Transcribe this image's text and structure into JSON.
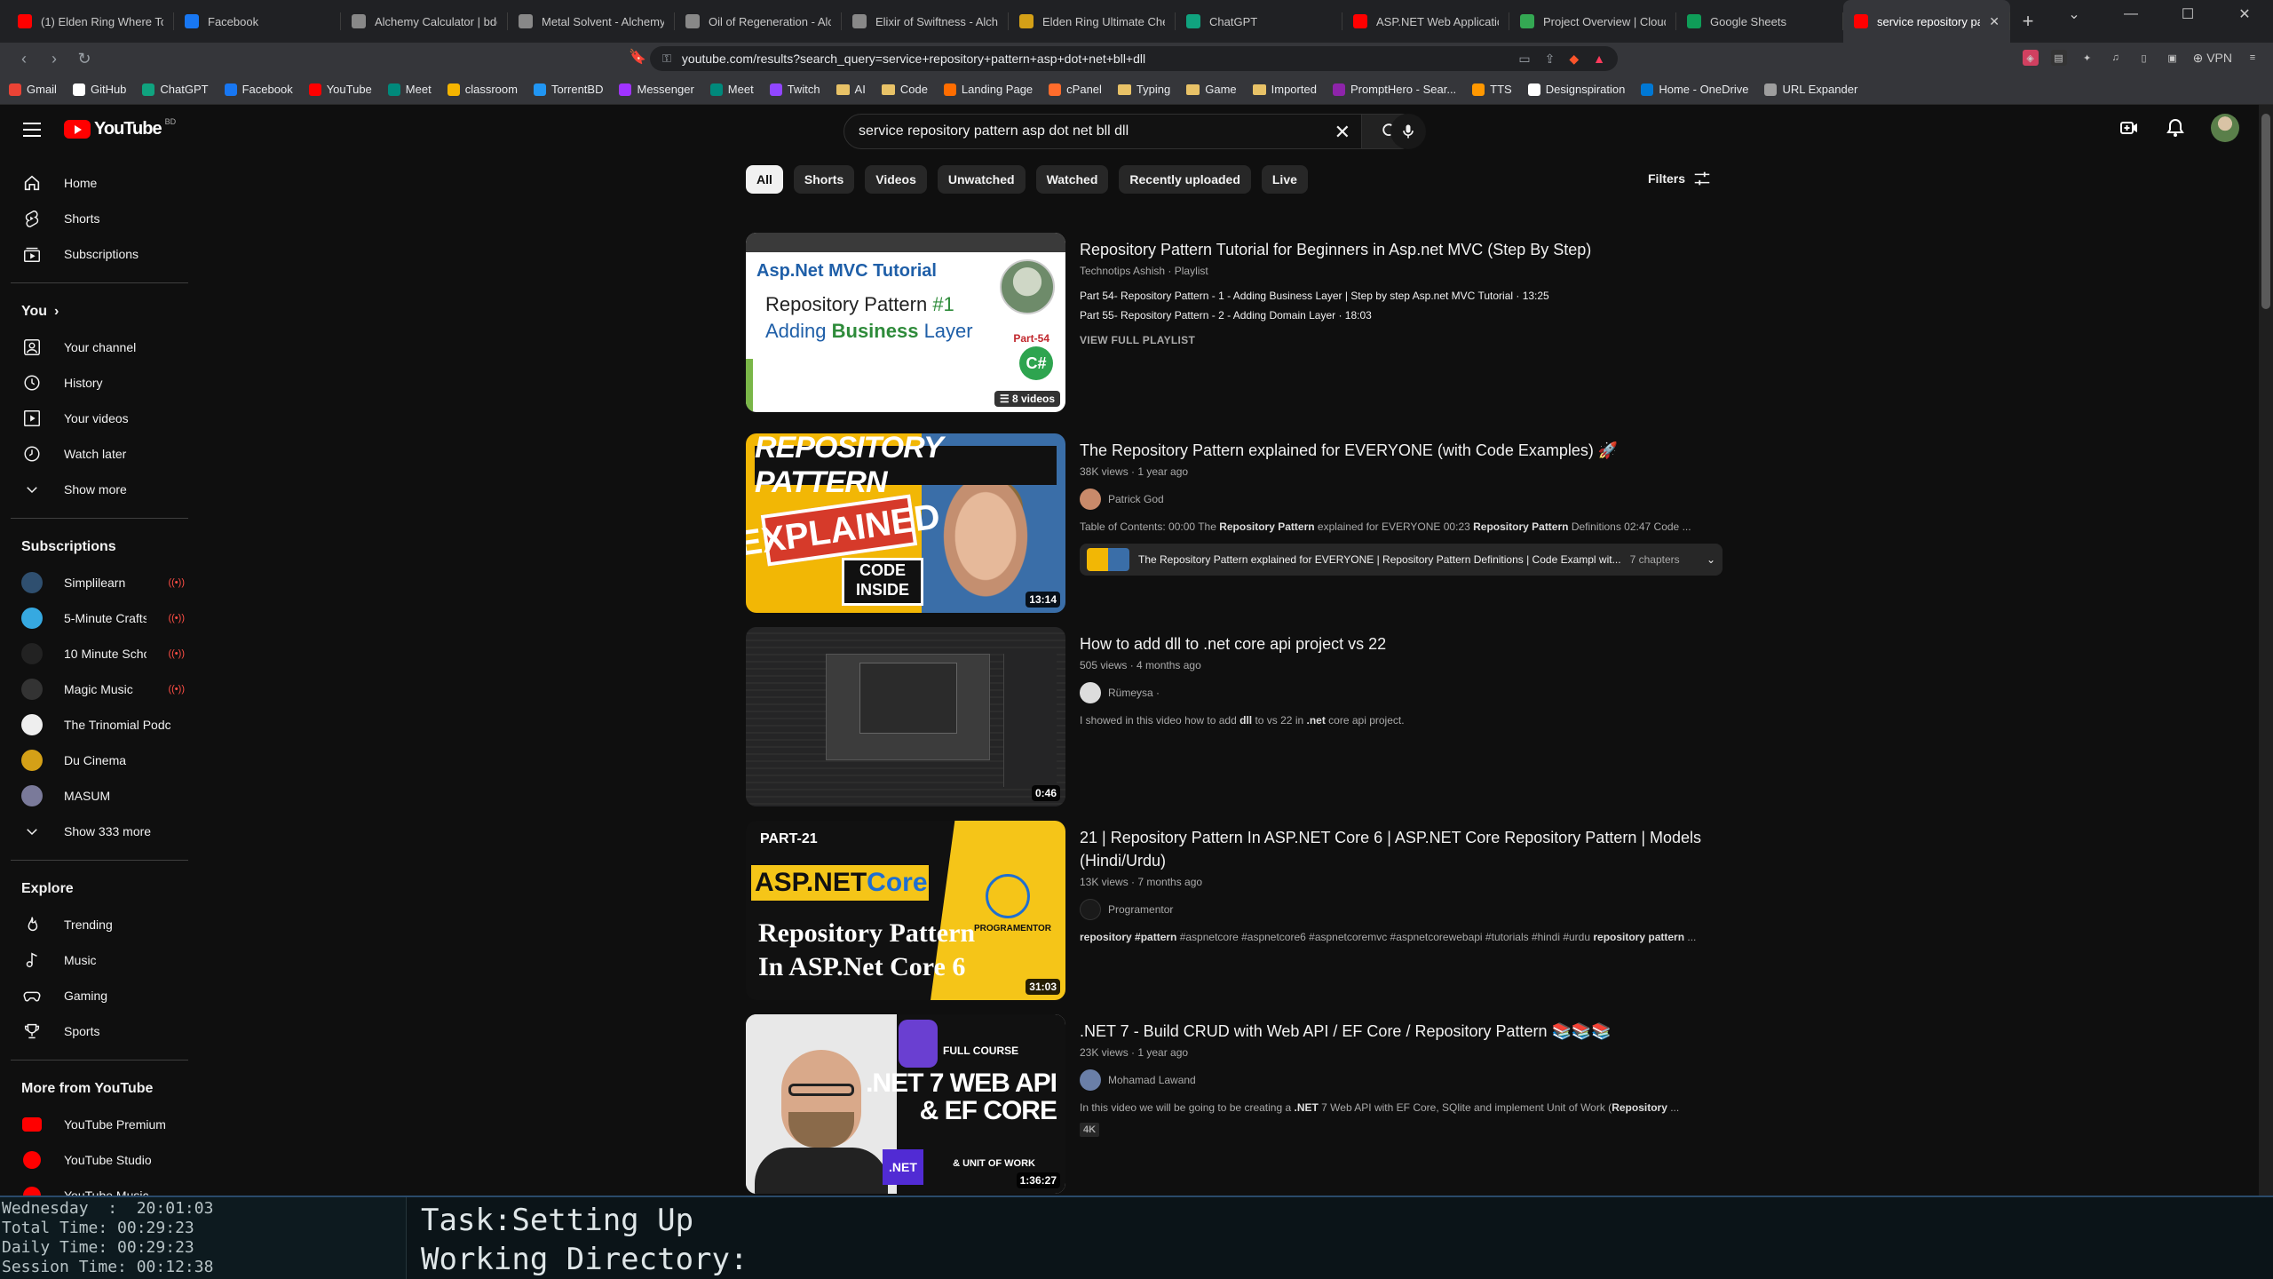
{
  "browser": {
    "tabs": [
      {
        "title": "(1) Elden Ring Where To Ge",
        "icon": "youtube-icon",
        "color": "#ff0000"
      },
      {
        "title": "Facebook",
        "icon": "facebook-icon",
        "color": "#1877f2"
      },
      {
        "title": "Alchemy Calculator | bdoly",
        "icon": "alchemy-icon",
        "color": "#888888"
      },
      {
        "title": "Metal Solvent - Alchemy Co",
        "icon": "alchemy-icon",
        "color": "#888888"
      },
      {
        "title": "Oil of Regeneration - Alche",
        "icon": "alchemy-icon",
        "color": "#888888"
      },
      {
        "title": "Elixir of Swiftness - Alchem",
        "icon": "alchemy-icon",
        "color": "#888888"
      },
      {
        "title": "Elden Ring Ultimate Cheat",
        "icon": "cheat-icon",
        "color": "#d4a017"
      },
      {
        "title": "ChatGPT",
        "icon": "chatgpt-icon",
        "color": "#10a37f"
      },
      {
        "title": "ASP.NET Web Application T",
        "icon": "youtube-icon",
        "color": "#ff0000"
      },
      {
        "title": "Project Overview | Cloud: M",
        "icon": "cloud-icon",
        "color": "#34a853"
      },
      {
        "title": "Google Sheets",
        "icon": "sheets-icon",
        "color": "#0f9d58"
      },
      {
        "title": "service repository patte",
        "icon": "youtube-icon",
        "color": "#ff0000",
        "active": true
      }
    ],
    "new_tab": "+",
    "url": "youtube.com/results?search_query=service+repository+pattern+asp+dot+net+bll+dll",
    "vpn_label": "VPN",
    "bookmarks": [
      {
        "label": "Gmail",
        "icon": "gmail-icon",
        "color": "#ea4335"
      },
      {
        "label": "GitHub",
        "icon": "github-icon",
        "color": "#ffffff"
      },
      {
        "label": "ChatGPT",
        "icon": "chatgpt-icon",
        "color": "#10a37f"
      },
      {
        "label": "Facebook",
        "icon": "facebook-icon",
        "color": "#1877f2"
      },
      {
        "label": "YouTube",
        "icon": "youtube-icon",
        "color": "#ff0000"
      },
      {
        "label": "Meet",
        "icon": "meet-icon",
        "color": "#00897b"
      },
      {
        "label": "classroom",
        "icon": "classroom-icon",
        "color": "#f4b400"
      },
      {
        "label": "TorrentBD",
        "icon": "torrent-icon",
        "color": "#2196f3"
      },
      {
        "label": "Messenger",
        "icon": "messenger-icon",
        "color": "#a033ff"
      },
      {
        "label": "Meet",
        "icon": "meet-icon",
        "color": "#00897b"
      },
      {
        "label": "Twitch",
        "icon": "twitch-icon",
        "color": "#9146ff"
      },
      {
        "label": "AI",
        "icon": "folder-icon",
        "color": "#e8c267"
      },
      {
        "label": "Code",
        "icon": "folder-icon",
        "color": "#e8c267"
      },
      {
        "label": "Landing Page",
        "icon": "landing-icon",
        "color": "#ff6d00"
      },
      {
        "label": "cPanel",
        "icon": "cpanel-icon",
        "color": "#ff6c2c"
      },
      {
        "label": "Typing",
        "icon": "folder-icon",
        "color": "#e8c267"
      },
      {
        "label": "Game",
        "icon": "folder-icon",
        "color": "#e8c267"
      },
      {
        "label": "Imported",
        "icon": "folder-icon",
        "color": "#e8c267"
      },
      {
        "label": "PromptHero - Sear...",
        "icon": "prompthero-icon",
        "color": "#8e24aa"
      },
      {
        "label": "TTS",
        "icon": "tts-icon",
        "color": "#ff9800"
      },
      {
        "label": "Designspiration",
        "icon": "designspiration-icon",
        "color": "#ffffff"
      },
      {
        "label": "Home - OneDrive",
        "icon": "onedrive-icon",
        "color": "#0078d4"
      },
      {
        "label": "URL Expander",
        "icon": "url-expander-icon",
        "color": "#9e9e9e"
      }
    ]
  },
  "youtube": {
    "logo_text": "YouTube",
    "country_code": "BD",
    "search_query": "service repository pattern asp dot net bll dll",
    "sidebar": {
      "main": [
        "Home",
        "Shorts",
        "Subscriptions"
      ],
      "you_header": "You",
      "you_items": [
        "Your channel",
        "History",
        "Your videos",
        "Watch later",
        "Show more"
      ],
      "subs_header": "Subscriptions",
      "subscriptions": [
        {
          "name": "Simplilearn",
          "color": "#2f4f6f",
          "live": true
        },
        {
          "name": "5-Minute Crafts",
          "color": "#36a9e1",
          "live": true
        },
        {
          "name": "10 Minute School",
          "color": "#222222",
          "live": true
        },
        {
          "name": "Magic Music",
          "color": "#333333",
          "live": true
        },
        {
          "name": "The Trinomial Podc...",
          "color": "#eeeeee",
          "live": false
        },
        {
          "name": "Du Cinema",
          "color": "#d4a017",
          "live": false
        },
        {
          "name": "MASUM",
          "color": "#7a7a9a",
          "live": false
        }
      ],
      "show_more_subs": "Show 333 more",
      "explore_header": "Explore",
      "explore": [
        "Trending",
        "Music",
        "Gaming",
        "Sports"
      ],
      "more_header": "More from YouTube",
      "more": [
        "YouTube Premium",
        "YouTube Studio",
        "YouTube Music"
      ]
    },
    "chips": [
      "All",
      "Shorts",
      "Videos",
      "Unwatched",
      "Watched",
      "Recently uploaded",
      "Live"
    ],
    "filters_label": "Filters",
    "results": [
      {
        "title": "Repository Pattern Tutorial for Beginners in Asp.net MVC (Step By Step)",
        "meta": "Technotips Ashish · Playlist",
        "playlist_items": [
          "Part 54- Repository Pattern - 1 - Adding Business Layer | Step by step Asp.net MVC Tutorial · 13:25",
          "Part 55- Repository Pattern - 2 - Adding Domain Layer · 18:03"
        ],
        "view_playlist": "VIEW FULL PLAYLIST",
        "video_count": "8 videos",
        "thumb_text": {
          "l1": "Asp.Net MVC Tutorial",
          "l2a": "Repository Pattern ",
          "l2b": "#1",
          "l3a": "Adding ",
          "l3b": "Business",
          "l3c": " Layer",
          "part": "Part-54",
          "cs": "C#"
        }
      },
      {
        "title": "The Repository Pattern explained for EVERYONE (with Code Examples) 🚀",
        "meta": "38K views · 1 year ago",
        "channel": "Patrick God",
        "channel_color": "#c98a6a",
        "description_html_parts": [
          "Table of Contents: 00:00 The ",
          "Repository Pattern",
          " explained for EVERYONE 00:23 ",
          "Repository Pattern",
          " Definitions 02:47 Code ..."
        ],
        "chapters_text": "The Repository Pattern explained for EVERYONE | Repository Pattern Definitions | Code Exampl wit...",
        "chapters_count": "7 chapters",
        "duration": "13:14",
        "thumb_text": {
          "banner": "REPOSITORY PATTERN",
          "explained": "EXPLAINED",
          "code": "CODE INSIDE"
        }
      },
      {
        "title": "How to add dll to .net core api project vs 22",
        "meta": "505 views · 4 months ago",
        "channel": "Rümeysa ·",
        "channel_color": "#dddddd",
        "description_html_parts": [
          "I showed in this video how to add ",
          "dll",
          " to vs 22 in ",
          ".net",
          " core api project."
        ],
        "duration": "0:46"
      },
      {
        "title": "21 | Repository Pattern In ASP.NET Core 6 | ASP.NET Core Repository Pattern | Models (Hindi/Urdu)",
        "meta": "13K views · 7 months ago",
        "channel": "Programentor",
        "channel_color": "#1a1a1a",
        "description_html_parts": [
          "repository",
          " ",
          "#pattern",
          " #aspnetcore #aspnetcore6 #aspnetcoremvc #aspnetcorewebapi #tutorials #hindi #urdu ",
          "repository pattern",
          " ..."
        ],
        "duration": "31:03",
        "thumb_text": {
          "part": "PART-21",
          "asp": "ASP.NET ",
          "core": "Core",
          "rp1": "Repository Pattern",
          "rp2": "In ASP.Net Core 6",
          "brand": "PROGRAMENTOR"
        }
      },
      {
        "title": ".NET 7 - Build CRUD with Web API / EF Core / Repository Pattern 📚📚📚",
        "meta": "23K views · 1 year ago",
        "channel": "Mohamad Lawand",
        "channel_color": "#6a7fa8",
        "description_html_parts": [
          "In this video we will be going to be creating a ",
          ".NET",
          " 7 Web API with EF Core, SQlite and implement Unit of Work (",
          "Repository",
          " ..."
        ],
        "badge": "4K",
        "duration": "1:36:27",
        "thumb_text": {
          "fc": "FULL COURSE",
          "big": ".NET 7 WEB API & EF CORE",
          "uow": "& UNIT OF WORK",
          "net": ".NET"
        }
      }
    ]
  },
  "status_bar": {
    "day_line": "Wednesday  :  20:01:03",
    "total_time": "Total Time: 00:29:23",
    "daily_time": "Daily Time: 00:29:23",
    "session_time": "Session Time: 00:12:38",
    "task": "Task:Setting Up",
    "working_dir": "Working Directory:"
  }
}
